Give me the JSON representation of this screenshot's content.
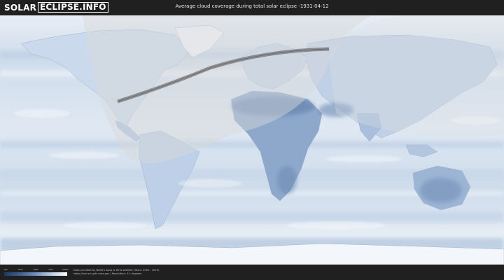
{
  "header": {
    "logo_solar": "SOLAR",
    "logo_eclipse": "ECLIPSE.INFO",
    "title": "Average cloud coverage during total solar eclipse -1931-04-12"
  },
  "footer": {
    "scale_ticks": [
      "0%",
      "25%",
      "50%",
      "75%",
      "100%"
    ],
    "attribution_line1": "Data provided by NASA's Aqua & Terra satellite (Years: 2000 - 2019)",
    "attribution_line2": "https://neo.sci.gsfc.nasa.gov | Resolution: 0.1 degrees"
  },
  "colors": {
    "background": "#1f1f1f",
    "cloud_clear": "#2f4f7a",
    "cloud_full": "#ffffff",
    "eclipse_path": "#6e6e6e",
    "visibility_overlay": "#d9d9d9"
  }
}
